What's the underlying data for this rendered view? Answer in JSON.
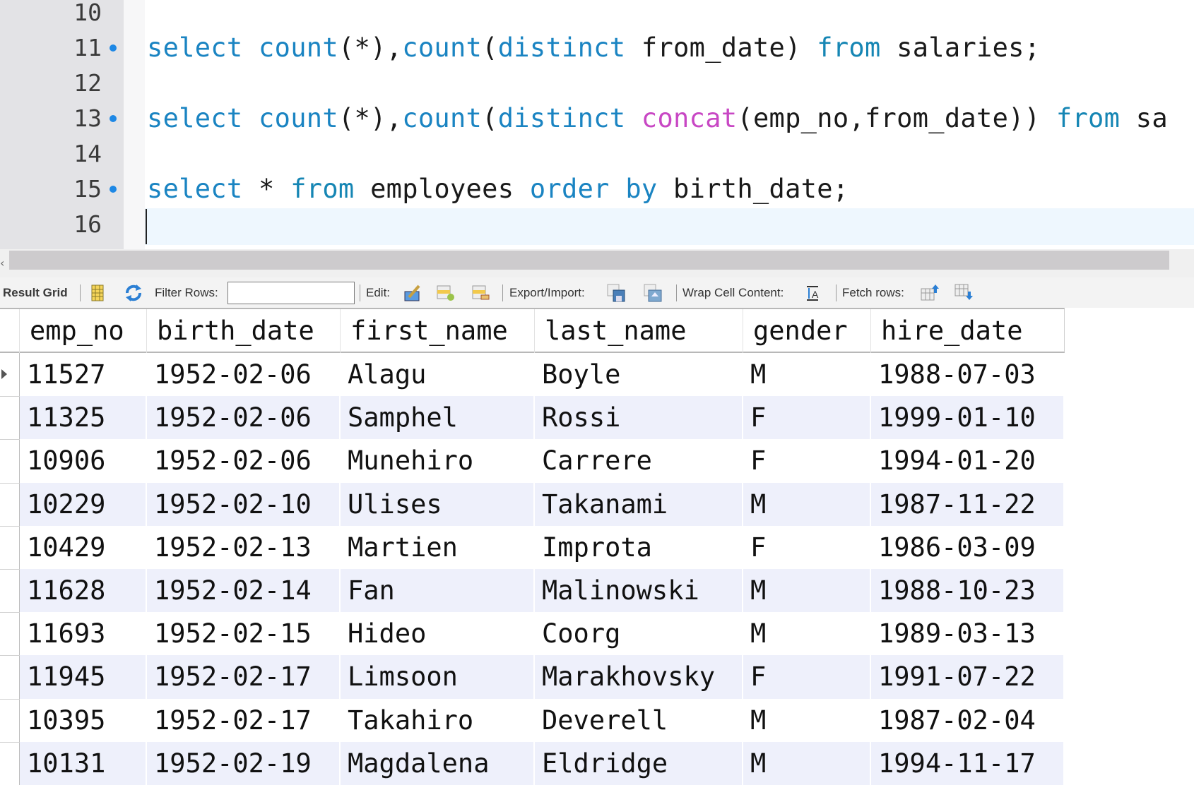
{
  "editor": {
    "lines": [
      {
        "number": "10",
        "marker": false,
        "tokens": []
      },
      {
        "number": "11",
        "marker": true,
        "tokens": [
          {
            "t": "select",
            "c": "kw"
          },
          {
            "t": " ",
            "c": "id"
          },
          {
            "t": "count",
            "c": "fn"
          },
          {
            "t": "(*),",
            "c": "id"
          },
          {
            "t": "count",
            "c": "fn"
          },
          {
            "t": "(",
            "c": "id"
          },
          {
            "t": "distinct",
            "c": "kw"
          },
          {
            "t": " from_date) ",
            "c": "id"
          },
          {
            "t": "from",
            "c": "from"
          },
          {
            "t": " salaries;",
            "c": "id"
          }
        ]
      },
      {
        "number": "12",
        "marker": false,
        "tokens": []
      },
      {
        "number": "13",
        "marker": true,
        "tokens": [
          {
            "t": "select",
            "c": "kw"
          },
          {
            "t": " ",
            "c": "id"
          },
          {
            "t": "count",
            "c": "fn"
          },
          {
            "t": "(*),",
            "c": "id"
          },
          {
            "t": "count",
            "c": "fn"
          },
          {
            "t": "(",
            "c": "id"
          },
          {
            "t": "distinct",
            "c": "kw"
          },
          {
            "t": " ",
            "c": "id"
          },
          {
            "t": "concat",
            "c": "concat"
          },
          {
            "t": "(emp_no,from_date)) ",
            "c": "id"
          },
          {
            "t": "from",
            "c": "from"
          },
          {
            "t": " sa",
            "c": "id"
          }
        ]
      },
      {
        "number": "14",
        "marker": false,
        "tokens": []
      },
      {
        "number": "15",
        "marker": true,
        "tokens": [
          {
            "t": "select",
            "c": "kw"
          },
          {
            "t": " * ",
            "c": "id"
          },
          {
            "t": "from",
            "c": "from"
          },
          {
            "t": " employees ",
            "c": "id"
          },
          {
            "t": "order by",
            "c": "kw"
          },
          {
            "t": " birth_date;",
            "c": "id"
          }
        ]
      },
      {
        "number": "16",
        "marker": false,
        "tokens": [],
        "current": true
      }
    ]
  },
  "scrollbar": {
    "left_arrow": "‹"
  },
  "toolbar": {
    "result_grid_label": "Result Grid",
    "filter_rows_label": "Filter Rows:",
    "filter_rows_value": "",
    "edit_label": "Edit:",
    "export_import_label": "Export/Import:",
    "wrap_cell_label": "Wrap Cell Content:",
    "fetch_rows_label": "Fetch rows:",
    "icons": {
      "grid_view": "form-grid-icon",
      "refresh": "refresh-icon",
      "edit_cell": "edit-cell-icon",
      "add_row": "add-row-icon",
      "delete_row": "delete-row-icon",
      "export": "export-save-icon",
      "import": "import-icon",
      "wrap": "wrap-text-icon",
      "fetch_prev": "fetch-previous-icon",
      "fetch_next": "fetch-next-icon"
    }
  },
  "grid": {
    "columns": [
      "emp_no",
      "birth_date",
      "first_name",
      "last_name",
      "gender",
      "hire_date"
    ],
    "rows": [
      [
        "11527",
        "1952-02-06",
        "Alagu",
        "Boyle",
        "M",
        "1988-07-03"
      ],
      [
        "11325",
        "1952-02-06",
        "Samphel",
        "Rossi",
        "F",
        "1999-01-10"
      ],
      [
        "10906",
        "1952-02-06",
        "Munehiro",
        "Carrere",
        "F",
        "1994-01-20"
      ],
      [
        "10229",
        "1952-02-10",
        "Ulises",
        "Takanami",
        "M",
        "1987-11-22"
      ],
      [
        "10429",
        "1952-02-13",
        "Martien",
        "Improta",
        "F",
        "1986-03-09"
      ],
      [
        "11628",
        "1952-02-14",
        "Fan",
        "Malinowski",
        "M",
        "1988-10-23"
      ],
      [
        "11693",
        "1952-02-15",
        "Hideo",
        "Coorg",
        "M",
        "1989-03-13"
      ],
      [
        "11945",
        "1952-02-17",
        "Limsoon",
        "Marakhovsky",
        "F",
        "1991-07-22"
      ],
      [
        "10395",
        "1952-02-17",
        "Takahiro",
        "Deverell",
        "M",
        "1987-02-04"
      ],
      [
        "10131",
        "1952-02-19",
        "Magdalena",
        "Eldridge",
        "M",
        "1994-11-17"
      ]
    ],
    "selected_row": 0
  },
  "colors": {
    "keyword": "#1a84c2",
    "function_concat": "#c847c4",
    "row_stripe": "#eef0fb",
    "current_line": "#eef7fe",
    "gutter": "#e3e3e6"
  }
}
